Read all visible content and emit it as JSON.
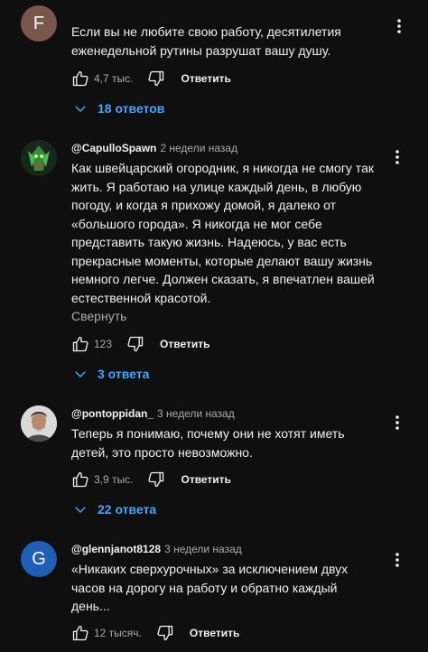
{
  "comments": [
    {
      "avatar_letter": "F",
      "avatar_color": "#7a574a",
      "text": "Если вы не любите свою работу, десятилетия еженедельной рутины разрушат вашу душу.",
      "likes": "4,7 тыс.",
      "reply_label": "Ответить",
      "replies_label": "18 ответов"
    },
    {
      "author": "@CapulloSpawn",
      "time": "2 недели назад",
      "text": "Как швейцарский огородник, я никогда не смогу так жить. Я работаю на улице каждый день, в любую погоду, и когда я прихожу домой, я далеко от «большого города». Я никогда не мог себе представить такую жизнь. Надеюсь, у вас есть прекрасные моменты, которые делают вашу жизнь немного легче. Должен сказать, я впечатлен вашей естественной красотой.",
      "collapse_label": "Свернуть",
      "likes": "123",
      "reply_label": "Ответить",
      "replies_label": "3 ответа"
    },
    {
      "author": "@pontoppidan_",
      "time": "3 недели назад",
      "text": "Теперь я понимаю, почему они не хотят иметь детей, это просто невозможно.",
      "likes": "3,9 тыс.",
      "reply_label": "Ответить",
      "replies_label": "22 ответа"
    },
    {
      "avatar_letter": "G",
      "avatar_color": "#1e5eb5",
      "author": "@glennjanot8128",
      "time": "3 недели назад",
      "text": "«Никаких сверхурочных» за исключением двух часов на дорогу на работу и обратно каждый день...",
      "likes": "12 тысяч.",
      "reply_label": "Ответить"
    }
  ],
  "colors": {
    "background": "#0f0f0f",
    "link": "#3ea6ff",
    "muted": "#aaaaaa",
    "text": "#f1f1f1"
  }
}
